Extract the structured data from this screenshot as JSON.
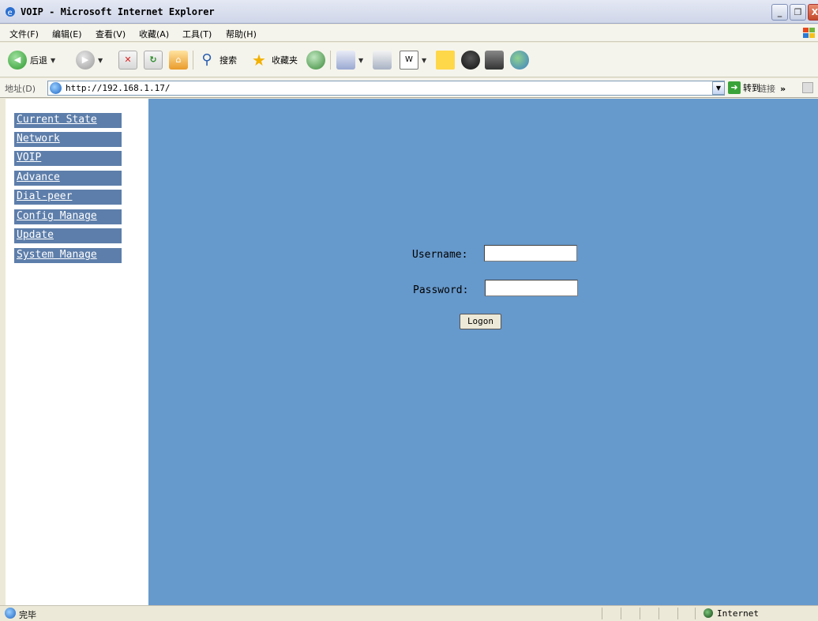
{
  "window": {
    "title": "VOIP - Microsoft Internet Explorer",
    "min_label": "_",
    "max_label": "❐",
    "close_label": "X"
  },
  "menu": {
    "items": [
      "文件(F)",
      "编辑(E)",
      "查看(V)",
      "收藏(A)",
      "工具(T)",
      "帮助(H)"
    ]
  },
  "toolbar": {
    "back_label": "后退",
    "search_label": "搜索",
    "favorites_label": "收藏夹"
  },
  "address": {
    "label": "地址(D)",
    "url": "http://192.168.1.17/",
    "go_label": "转到",
    "links_label": "链接"
  },
  "sidebar": {
    "items": [
      {
        "label": "Current State"
      },
      {
        "label": "Network"
      },
      {
        "label": "VOIP"
      },
      {
        "label": "Advance"
      },
      {
        "label": "Dial-peer"
      },
      {
        "label": "Config Manage"
      },
      {
        "label": "Update"
      },
      {
        "label": "System Manage"
      }
    ]
  },
  "login": {
    "username_label": "Username:",
    "username_value": "",
    "password_label": "Password:",
    "password_value": "",
    "logon_label": "Logon"
  },
  "status": {
    "text": "完毕",
    "zone": "Internet"
  },
  "colors": {
    "nav_bg": "#5d7eaa",
    "main_bg": "#6699cc"
  }
}
